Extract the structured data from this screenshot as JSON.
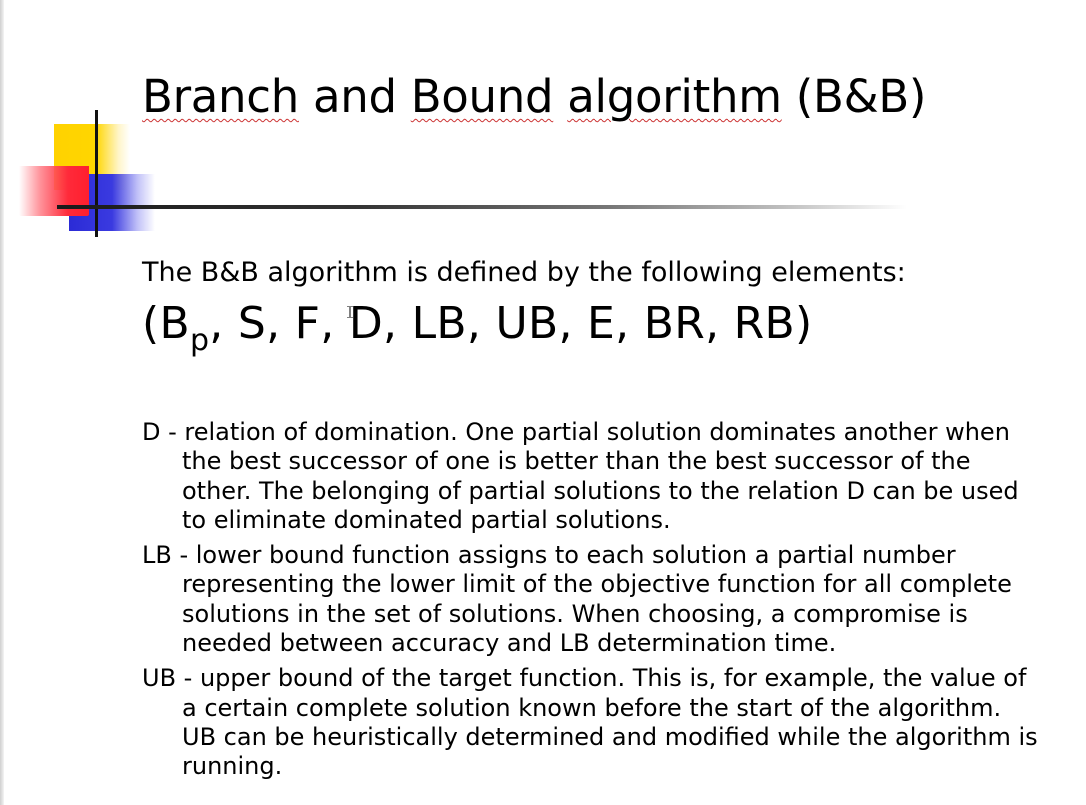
{
  "slide": {
    "title": "Branch and Bound algorithm (B&B)",
    "title_words": {
      "w1": "Branch",
      "w2": " and ",
      "w3": "Bound",
      "w4": " ",
      "w5": "algorithm",
      "w6": " (B&B)"
    },
    "intro": "The B&B algorithm is defined by the following elements:",
    "tuple": {
      "open": "(B",
      "subscript": "p",
      "rest": ", S, F, D, LB, UB, E, BR, RB)"
    },
    "definitions": [
      {
        "term": "D",
        "text": "D - relation of domination. One partial solution dominates another when the best successor of one is better than the best successor of the other. The belonging of partial solutions to the relation D can be used to eliminate dominated partial solutions."
      },
      {
        "term": "LB",
        "text": "LB - lower bound function assigns to each solution a partial number representing the lower limit of the objective function for all complete solutions in the set of solutions. When choosing, a compromise is needed between accuracy and LB determination time."
      },
      {
        "term": "UB",
        "text": "UB - upper bound of the target function. This is, for example, the value of a certain complete solution known before the start of the algorithm. UB can be heuristically determined and modified while the algorithm is running."
      }
    ]
  },
  "colors": {
    "accent_yellow": "#ffd200",
    "accent_blue": "#2b2bd6",
    "accent_red": "#ff2a3a",
    "text": "#000000",
    "spellcheck_underline": "#cc3333"
  },
  "icons": {
    "cursor": "text-cursor-icon",
    "decoration": "slide-corner-squares-icon"
  }
}
